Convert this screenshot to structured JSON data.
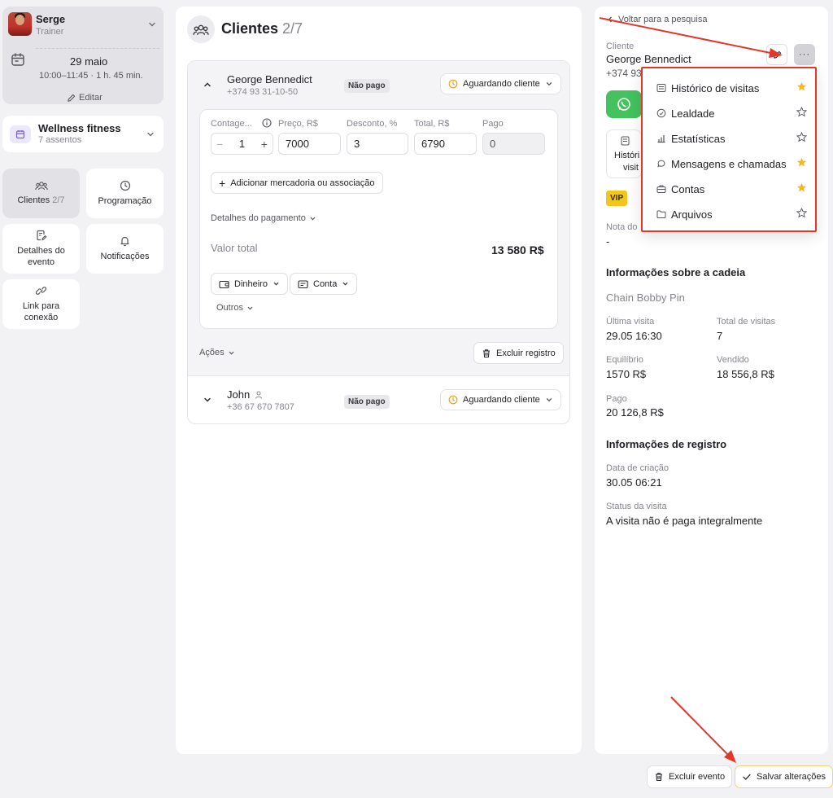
{
  "trainer": {
    "name": "Serge",
    "role": "Trainer",
    "date": "29 maio",
    "time": "10:00–11:45 · 1 h. 45 min.",
    "edit_label": "Editar"
  },
  "room": {
    "name": "Wellness fitness",
    "seats": "7 assentos"
  },
  "nav": {
    "clients_label": "Clientes",
    "clients_count": "2/7",
    "schedule_label": "Programação",
    "details_label1": "Detalhes do",
    "details_label2": "evento",
    "notifications_label": "Notificações",
    "link_label1": "Link para",
    "link_label2": "conexão"
  },
  "clients_panel": {
    "title": "Clientes",
    "count": "2/7"
  },
  "client1": {
    "name": "George Bennedict",
    "phone": "+374 93 31-10-50",
    "payment_badge": "Não pago",
    "status": "Aguardando cliente",
    "fields": {
      "count_label": "Contage...",
      "count_value": "1",
      "price_label": "Preço, R$",
      "price_value": "7000",
      "discount_label": "Desconto, %",
      "discount_value": "3",
      "total_label": "Total, R$",
      "total_value": "6790",
      "paid_label": "Pago",
      "paid_value": "0"
    },
    "add_item_label": "Adicionar mercadoria ou associação",
    "payment_details_label": "Detalhes do pagamento",
    "total_text": "Valor total",
    "total_amount": "13 580 R$",
    "method_cash": "Dinheiro",
    "method_account": "Conta",
    "others_label": "Outros",
    "actions_label": "Ações",
    "delete_record_label": "Excluir registro"
  },
  "client2": {
    "name": "John",
    "phone": "+36 67 670 7807",
    "payment_badge": "Não pago",
    "status": "Aguardando cliente"
  },
  "right": {
    "back_label": "Voltar para a pesquisa",
    "client_label": "Cliente",
    "client_name": "George Bennedict",
    "client_phone_partial": "+374 93",
    "history_partial1": "Históri",
    "history_partial2": "visit",
    "vip_label": "VIP",
    "note_label": "Nota do",
    "note_value": "-",
    "chain_heading": "Informações sobre a cadeia",
    "chain_name": "Chain Bobby Pin",
    "last_visit_label": "Última visita",
    "last_visit_value": "29.05 16:30",
    "total_visits_label": "Total de visitas",
    "total_visits_value": "7",
    "balance_label": "Equilíbrio",
    "balance_value": "1570 R$",
    "sold_label": "Vendido",
    "sold_value": "18 556,8 R$",
    "paid_label": "Pago",
    "paid_value": "20 126,8 R$",
    "reg_heading": "Informações de registro",
    "created_label": "Data de criação",
    "created_value": "30.05 06:21",
    "visit_status_label": "Status da visita",
    "visit_status_value": "A visita não é paga integralmente"
  },
  "dropdown": {
    "items": [
      {
        "label": "Histórico de visitas",
        "icon": "list-icon",
        "starred": true
      },
      {
        "label": "Lealdade",
        "icon": "loyalty-icon",
        "starred": false
      },
      {
        "label": "Estatísticas",
        "icon": "bar-chart-icon",
        "starred": false
      },
      {
        "label": "Mensagens e chamadas",
        "icon": "chat-icon",
        "starred": true
      },
      {
        "label": "Contas",
        "icon": "briefcase-icon",
        "starred": true
      },
      {
        "label": "Arquivos",
        "icon": "folder-icon",
        "starred": false
      }
    ]
  },
  "footer": {
    "delete_event_label": "Excluir evento",
    "save_label": "Salvar alterações"
  },
  "colors": {
    "accent_red": "#e0392b",
    "star_yellow": "#f5b81f",
    "whatsapp_green": "#43c25e",
    "vip_yellow": "#f2c51f",
    "save_border": "#f3d27a"
  }
}
